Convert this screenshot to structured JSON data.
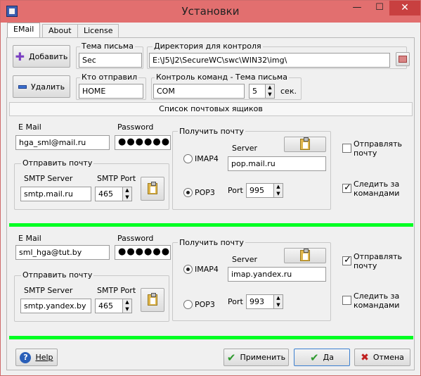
{
  "window": {
    "title": "Установки"
  },
  "tabs": [
    {
      "label": "EMail"
    },
    {
      "label": "About"
    },
    {
      "label": "License"
    }
  ],
  "top": {
    "add_label": "Добавить",
    "delete_label": "Удалить",
    "subject_label": "Тема письма",
    "subject_value": "Sec",
    "dir_label": "Директория для контроля",
    "dir_value": "E:\\J5\\J2\\SecureWC\\swc\\WIN32\\img\\",
    "sender_label": "Кто отправил",
    "sender_value": "HOME",
    "cmd_label": "Контроль команд - Тема письма",
    "cmd_value": "COM",
    "interval_value": "5",
    "interval_unit": "сек."
  },
  "list_header": "Список почтовых ящиков",
  "mailboxes": [
    {
      "email_label": "E Mail",
      "email": "hga_sml@mail.ru",
      "password_label": "Password",
      "password": "●●●●●●●●●",
      "send_group": "Отправить почту",
      "smtp_server_label": "SMTP Server",
      "smtp_server": "smtp.mail.ru",
      "smtp_port_label": "SMTP Port",
      "smtp_port": "465",
      "recv_group": "Получить почту",
      "server_label": "Server",
      "server": "pop.mail.ru",
      "imap_label": "IMAP4",
      "pop3_label": "POP3",
      "port_label": "Port",
      "port": "995",
      "send_check_label": "Отправлять почту",
      "send_checked": false,
      "watch_check_label": "Следить за командами",
      "watch_checked": true,
      "protocol": "POP3"
    },
    {
      "email_label": "E Mail",
      "email": "sml_hga@tut.by",
      "password_label": "Password",
      "password": "●●●●●●●●●",
      "send_group": "Отправить почту",
      "smtp_server_label": "SMTP Server",
      "smtp_server": "smtp.yandex.by",
      "smtp_port_label": "SMTP Port",
      "smtp_port": "465",
      "recv_group": "Получить почту",
      "server_label": "Server",
      "server": "imap.yandex.ru",
      "imap_label": "IMAP4",
      "pop3_label": "POP3",
      "port_label": "Port",
      "port": "993",
      "send_check_label": "Отправлять почту",
      "send_checked": true,
      "watch_check_label": "Следить за командами",
      "watch_checked": false,
      "protocol": "IMAP4"
    }
  ],
  "bottom": {
    "help_label": "Help",
    "apply_label": "Применить",
    "ok_label": "Да",
    "cancel_label": "Отмена"
  },
  "colors": {
    "titlebar": "#e26f6f",
    "separator": "#00ff22",
    "close": "#c84040"
  }
}
